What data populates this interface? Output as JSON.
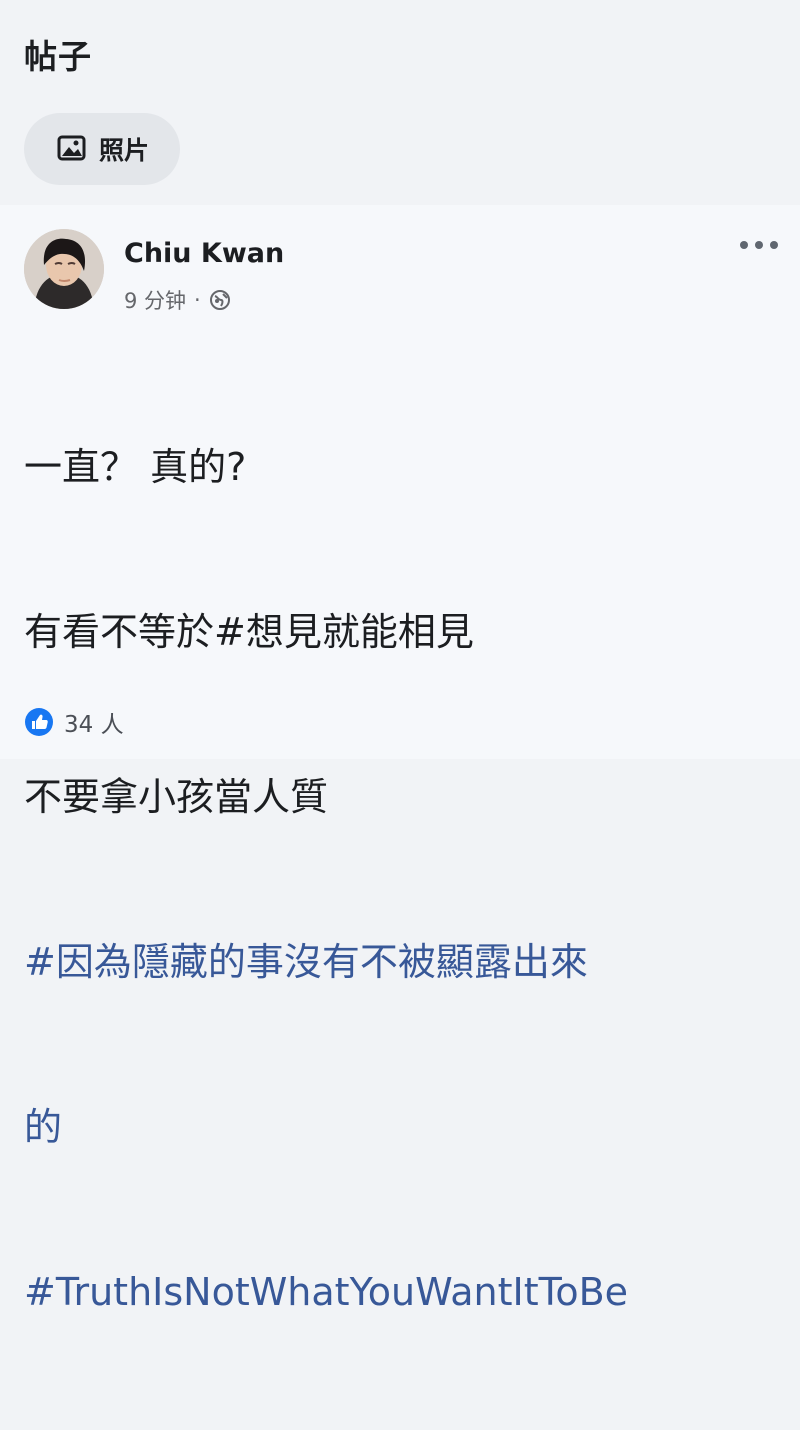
{
  "section": {
    "title": "帖子"
  },
  "filter": {
    "label": "照片",
    "icon": "photo-icon"
  },
  "post": {
    "author": "Chiu Kwan",
    "timestamp": "9 分钟",
    "separator": "·",
    "visibility_icon": "globe-icon",
    "menu_icon": "more-icon",
    "text_lines": [
      "一直？ 真的?",
      "有看不等於#想見就能相見",
      "不要拿小孩當人質"
    ],
    "hashtags": [
      "#因為隱藏的事沒有不被顯露出來",
      "的",
      "#TruthIsNotWhatYouWantItToBe"
    ],
    "reaction_icon": "like-icon",
    "reaction_count": "34 人"
  },
  "colors": {
    "background": "#f1f3f6",
    "post_background": "#f6f8fb",
    "text": "#1c1e21",
    "hashtag": "#385898",
    "muted": "#65676b",
    "like_blue": "#1877f2"
  }
}
